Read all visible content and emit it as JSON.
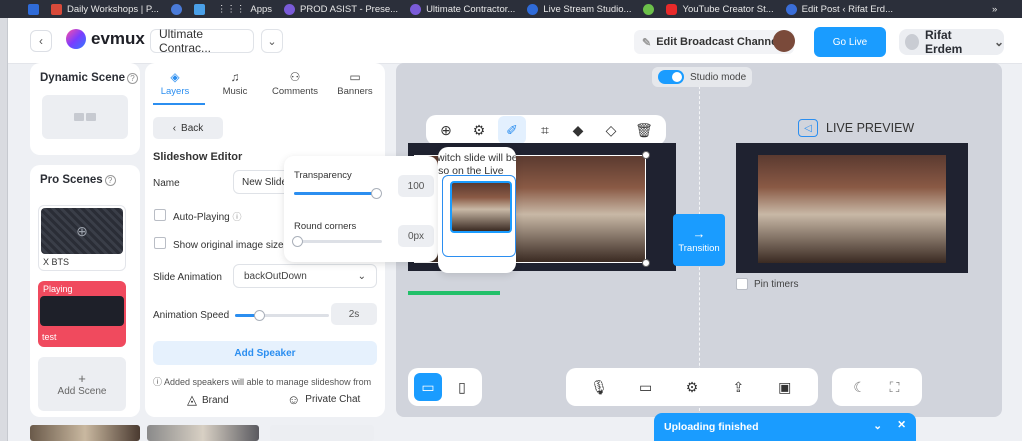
{
  "bookmarks": [
    {
      "label": "Daily Workshops | P...",
      "color": "#d84a3a"
    },
    {
      "label": "",
      "color": "#4a7bd8"
    },
    {
      "label": "",
      "color": "#4aa0e8"
    },
    {
      "label": "Apps",
      "color": "#cfd3da"
    },
    {
      "label": "PROD ASIST - Prese...",
      "color": "#7a5bd8"
    },
    {
      "label": "Ultimate Contractor...",
      "color": "#7a5bd8"
    },
    {
      "label": "Live Stream Studio...",
      "color": "#2f6bd8"
    },
    {
      "label": "",
      "color": "#6cc04a"
    },
    {
      "label": "YouTube Creator St...",
      "color": "#e82a2a"
    },
    {
      "label": "Edit Post ‹ Rifat Erd...",
      "color": "#3a6ed8"
    }
  ],
  "bookmarks_more": "»",
  "topbar": {
    "logo": "evmux",
    "project": "Ultimate Contrac...",
    "edit_channels": "Edit Broadcast Channels",
    "go_live": "Go Live",
    "user": "Rifat Erdem"
  },
  "dynamic_scene": {
    "title": "Dynamic Scene"
  },
  "pro_scenes": {
    "title": "Pro Scenes",
    "items": [
      {
        "label": "X BTS"
      },
      {
        "label": "test",
        "badge": "Playing"
      }
    ],
    "add_scene": "Add Scene",
    "add_plus": "+"
  },
  "editor": {
    "tabs": [
      "Layers",
      "Music",
      "Comments",
      "Banners"
    ],
    "back": "Back",
    "heading": "Slideshow Editor",
    "name_label": "Name",
    "name_value": "New Slides",
    "auto_playing": "Auto-Playing",
    "show_original": "Show original image size",
    "slide_animation_label": "Slide Animation",
    "slide_animation_value": "backOutDown",
    "animation_speed_label": "Animation Speed",
    "animation_speed_value": "2s",
    "animation_speed_level": 0.25,
    "add_speaker": "Add Speaker",
    "note": "ⓘ Added speakers will able to manage slideshow from",
    "brand": "Brand",
    "private_chat": "Private Chat"
  },
  "popover": {
    "transparency_label": "Transparency",
    "transparency_value": "100",
    "transparency_level": 1.0,
    "round_corners_label": "Round corners",
    "round_corners_value": "0px",
    "round_corners_level": 0.0
  },
  "tooltip": {
    "line1": "Switch slide will be",
    "line2": "also on the Live"
  },
  "stage": {
    "studio_mode": "Studio mode",
    "live_preview": "LIVE PREVIEW",
    "transition": "Transition",
    "transition_arrow": "→",
    "pin_timers": "Pin timers"
  },
  "toast": {
    "text": "Uploading finished"
  }
}
